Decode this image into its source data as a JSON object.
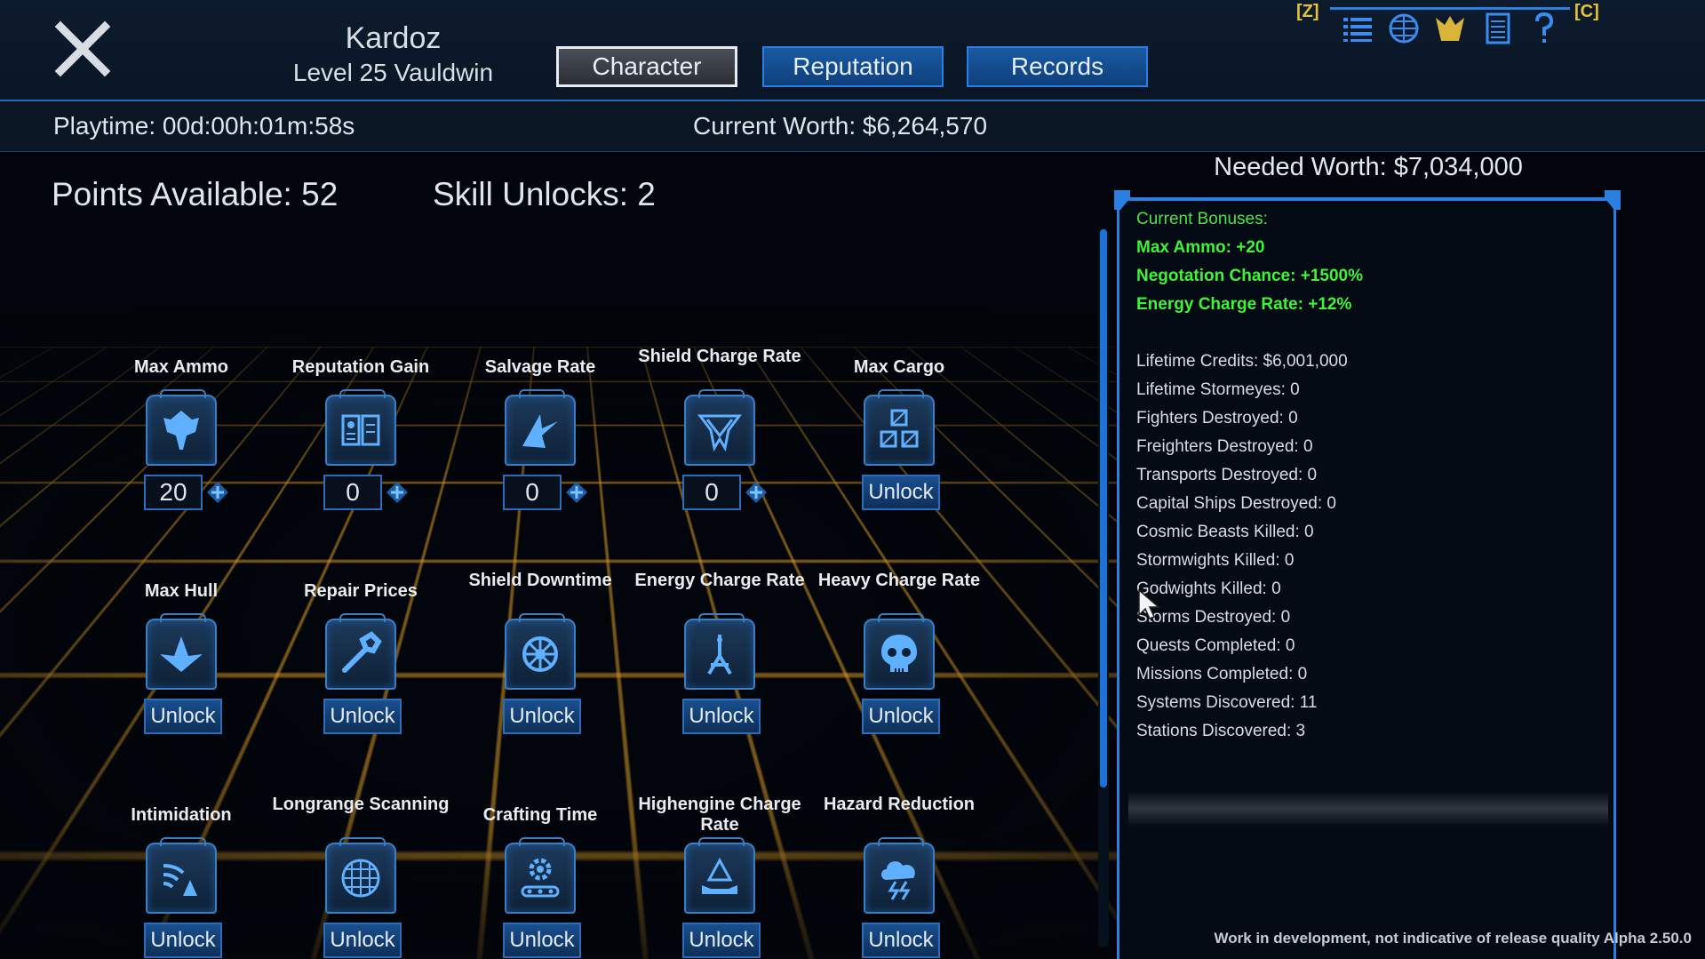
{
  "header": {
    "character_name": "Kardoz",
    "character_level": "Level 25 Vauldwin",
    "tabs": [
      "Character",
      "Reputation",
      "Records"
    ],
    "active_tab": "Character",
    "hotkey_left": "[Z]",
    "hotkey_right": "[C]",
    "tray_icons": [
      "list-icon",
      "globe-icon",
      "faction-icon",
      "journal-icon",
      "help-icon"
    ]
  },
  "info": {
    "playtime": "Playtime: 00d:00h:01m:58s",
    "current_worth": "Current Worth: $6,264,570"
  },
  "points_available": "Points Available: 52",
  "skill_unlocks": "Skill Unlocks: 2",
  "skills": [
    {
      "label": "Max Ammo",
      "icon": "ammo-icon",
      "value": "20",
      "action": ""
    },
    {
      "label": "Reputation Gain",
      "icon": "reputation-icon",
      "value": "0",
      "action": ""
    },
    {
      "label": "Salvage Rate",
      "icon": "salvage-icon",
      "value": "0",
      "action": ""
    },
    {
      "label": "Shield Charge Rate",
      "icon": "shield-charge-icon",
      "value": "0",
      "action": ""
    },
    {
      "label": "Max Cargo",
      "icon": "cargo-icon",
      "value": "",
      "action": "Unlock"
    },
    {
      "label": "Max Hull",
      "icon": "hull-icon",
      "value": "",
      "action": "Unlock"
    },
    {
      "label": "Repair Prices",
      "icon": "wrench-icon",
      "value": "",
      "action": "Unlock"
    },
    {
      "label": "Shield Downtime",
      "icon": "shield-downtime-icon",
      "value": "",
      "action": "Unlock"
    },
    {
      "label": "Energy Charge Rate",
      "icon": "energy-icon",
      "value": "",
      "action": "Unlock"
    },
    {
      "label": "Heavy Charge Rate",
      "icon": "skull-icon",
      "value": "",
      "action": "Unlock"
    },
    {
      "label": "Intimidation",
      "icon": "intimidation-icon",
      "value": "",
      "action": "Unlock"
    },
    {
      "label": "Longrange Scanning",
      "icon": "scanner-icon",
      "value": "",
      "action": "Unlock"
    },
    {
      "label": "Crafting Time",
      "icon": "crafting-icon",
      "value": "",
      "action": "Unlock"
    },
    {
      "label": "Highengine Charge Rate",
      "icon": "highengine-icon",
      "value": "",
      "action": "Unlock"
    },
    {
      "label": "Hazard Reduction",
      "icon": "hazard-icon",
      "value": "",
      "action": "Unlock"
    }
  ],
  "panel": {
    "needed_worth": "Needed Worth: $7,034,000",
    "bonuses_heading": "Current Bonuses:",
    "bonuses": [
      {
        "name": "Max Ammo:",
        "value": "+20"
      },
      {
        "name": "Negotation Chance:",
        "value": "+1500%"
      },
      {
        "name": "Energy Charge Rate:",
        "value": "+12%"
      }
    ],
    "stats": [
      "Lifetime Credits: $6,001,000",
      "Lifetime Stormeyes: 0",
      "Fighters Destroyed: 0",
      "Freighters Destroyed: 0",
      "Transports Destroyed: 0",
      "Capital Ships Destroyed: 0",
      "Cosmic Beasts Killed: 0",
      "Stormwights Killed: 0",
      "Godwights Killed: 0",
      "Storms Destroyed: 0",
      "Quests Completed: 0",
      "Missions Completed: 0",
      "Systems Discovered: 11",
      "Stations Discovered: 3"
    ]
  },
  "footer_note": "Work in development, not indicative of release quality Alpha 2.50.0",
  "colors": {
    "accent": "#2b7fe0",
    "bonus_green": "#3ff33a",
    "hotkey": "#e5c23a",
    "grid": "#d69622"
  }
}
